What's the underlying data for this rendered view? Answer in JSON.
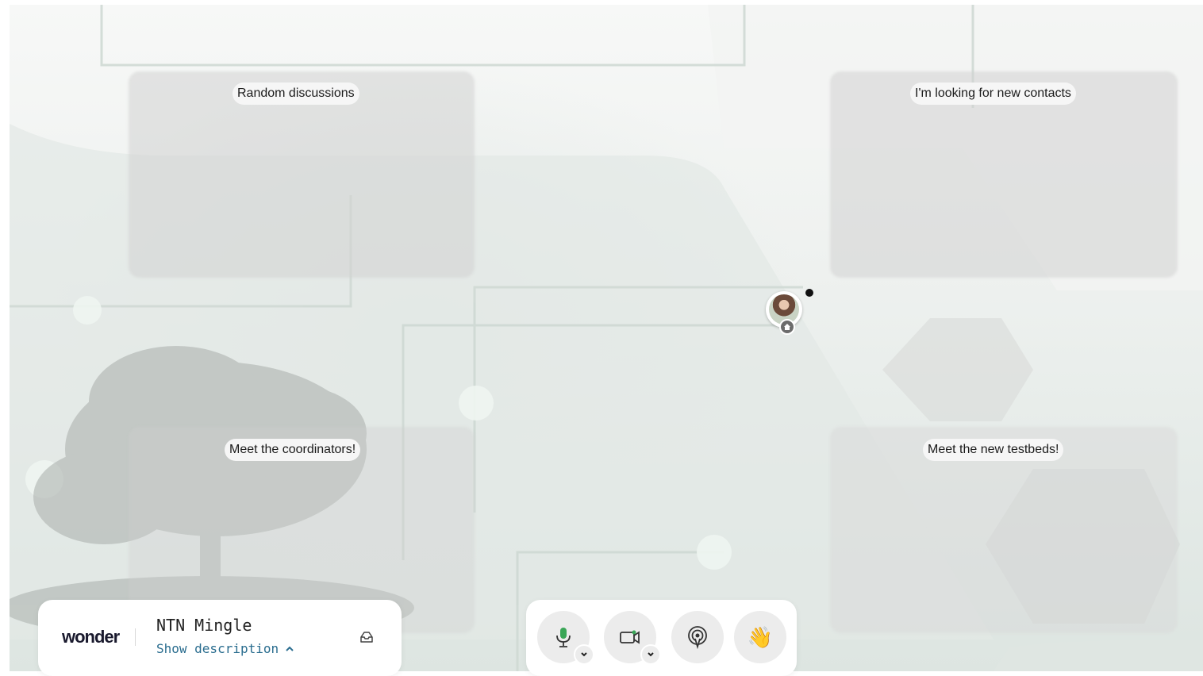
{
  "rooms": [
    {
      "label": "Random discussions"
    },
    {
      "label": "I'm looking for new contacts"
    },
    {
      "label": "Meet the coordinators!"
    },
    {
      "label": "Meet the new testbeds!"
    }
  ],
  "space": {
    "logo_text": "wonder",
    "name": "NTN Mingle",
    "show_description": "Show description"
  },
  "controls": {
    "mic": "microphone-icon",
    "camera": "video-camera-icon",
    "broadcast": "broadcast-icon",
    "wave": "👋"
  },
  "colors": {
    "accent_blue": "#2a6d8f",
    "mic_green": "#3aa657",
    "panel_bg": "#ffffff"
  }
}
